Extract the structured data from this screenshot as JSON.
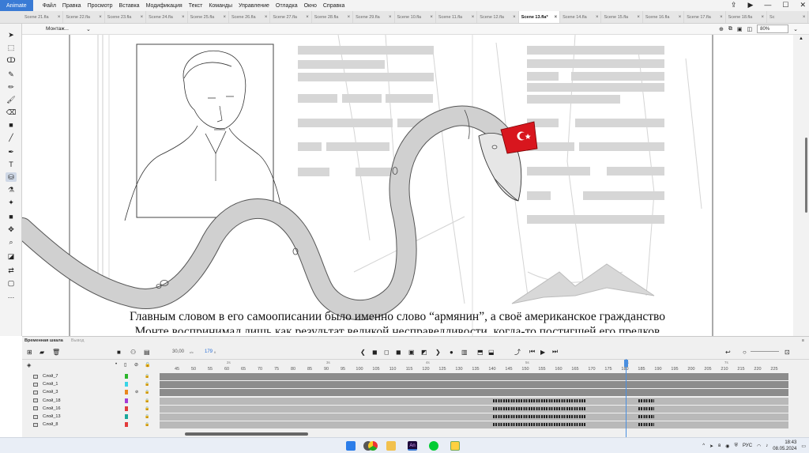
{
  "app": {
    "name": "Animate",
    "menus": [
      "Файл",
      "Правка",
      "Просмотр",
      "Вставка",
      "Модификация",
      "Текст",
      "Команды",
      "Управление",
      "Отладка",
      "Окно",
      "Справка"
    ]
  },
  "tabs": [
    {
      "label": "Scene 21.fla",
      "active": false
    },
    {
      "label": "Scene 22.fla",
      "active": false
    },
    {
      "label": "Scene 23.fla",
      "active": false
    },
    {
      "label": "Scene 24.fla",
      "active": false
    },
    {
      "label": "Scene 25.fla",
      "active": false
    },
    {
      "label": "Scene 26.fla",
      "active": false
    },
    {
      "label": "Scene 27.fla",
      "active": false
    },
    {
      "label": "Scene 28.fla",
      "active": false
    },
    {
      "label": "Scene 29.fla",
      "active": false
    },
    {
      "label": "Scene 10.fla",
      "active": false
    },
    {
      "label": "Scene 11.fla",
      "active": false
    },
    {
      "label": "Scene 12.fla",
      "active": false
    },
    {
      "label": "Scene 13.fla*",
      "active": true
    },
    {
      "label": "Scene 14.fla",
      "active": false
    },
    {
      "label": "Scene 15.fla",
      "active": false
    },
    {
      "label": "Scene 16.fla",
      "active": false
    },
    {
      "label": "Scene 17.fla",
      "active": false
    },
    {
      "label": "Scene 18.fla",
      "active": false
    },
    {
      "label": "Sc",
      "active": false
    }
  ],
  "editbar": {
    "scene_label": "Монтаж...",
    "zoom": "80%"
  },
  "caption": {
    "line1": "Главным словом в его самоописании было именно слово “армянин”, а своё американское гражданство",
    "line2": "Монте воспринимал лишь как результат великой несправедливости, когда-то постигшей его предков"
  },
  "timeline": {
    "panel_tab": "Временная шкала",
    "output_tab": "Вывод",
    "fps": "30,00",
    "fps_unit": "к/с",
    "current_frame": "179",
    "current_frame_unit": "К",
    "ruler_numbers": [
      "45",
      "50",
      "55",
      "60",
      "65",
      "70",
      "75",
      "80",
      "85",
      "90",
      "95",
      "100",
      "105",
      "110",
      "115",
      "120",
      "125",
      "130",
      "135",
      "140",
      "145",
      "150",
      "155",
      "160",
      "165",
      "170",
      "175",
      "180",
      "185",
      "190",
      "195",
      "200",
      "205",
      "210",
      "215",
      "220",
      "225"
    ],
    "seconds": [
      "2s",
      "3s",
      "4s",
      "5s",
      "6s",
      "7s"
    ],
    "layers": [
      {
        "name": "Слой_7",
        "color": "#2bb52b",
        "hidden": false,
        "dark": true,
        "keyframes": false
      },
      {
        "name": "Слой_1",
        "color": "#39d4e6",
        "hidden": false,
        "dark": true,
        "keyframes": false
      },
      {
        "name": "Слой_3",
        "color": "#e8871e",
        "hidden": true,
        "dark": true,
        "keyframes": false
      },
      {
        "name": "Слой_18",
        "color": "#a53bd6",
        "hidden": false,
        "dark": false,
        "keyframes": true
      },
      {
        "name": "Слой_16",
        "color": "#e03c3c",
        "hidden": false,
        "dark": false,
        "keyframes": true
      },
      {
        "name": "Слой_13",
        "color": "#1aa79b",
        "hidden": false,
        "dark": false,
        "keyframes": true
      },
      {
        "name": "Слой_8",
        "color": "#e23a3a",
        "hidden": false,
        "dark": false,
        "keyframes": true
      }
    ]
  },
  "taskbar": {
    "lang": "РУС",
    "time": "18:43",
    "date": "08.05.2024"
  },
  "colors": {
    "accent": "#3a7bd5",
    "snake_fill": "#d0d0d0",
    "fez": "#d8161e",
    "playhead": "#4a8fe0"
  }
}
